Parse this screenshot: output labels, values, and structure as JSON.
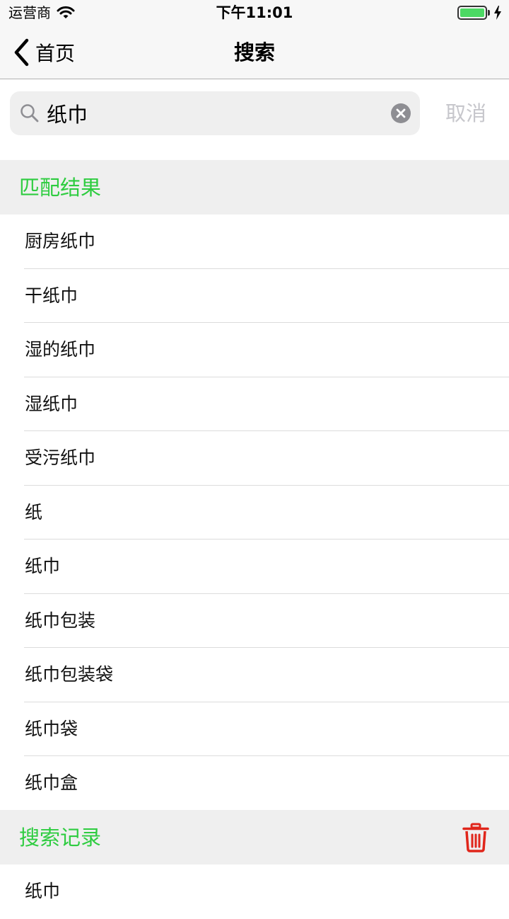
{
  "status_bar": {
    "carrier": "运营商",
    "time": "下午11:01",
    "battery_level": 1.0
  },
  "nav": {
    "back_label": "首页",
    "title": "搜索"
  },
  "search": {
    "value": "纸巾",
    "cancel_label": "取消"
  },
  "matches": {
    "title": "匹配结果",
    "items": [
      "厨房纸巾",
      "干纸巾",
      "湿的纸巾",
      "湿纸巾",
      "受污纸巾",
      "纸",
      "纸巾",
      "纸巾包装",
      "纸巾包装袋",
      "纸巾袋",
      "纸巾盒"
    ]
  },
  "history": {
    "title": "搜索记录",
    "items": [
      "纸巾"
    ]
  },
  "colors": {
    "accent_green": "#2ecc40",
    "trash_red": "#e0261b",
    "battery_green": "#4cd964"
  },
  "icons": {
    "back": "chevron-left-icon",
    "search": "magnifier-icon",
    "clear": "clear-circle-icon",
    "trash": "trash-icon"
  }
}
